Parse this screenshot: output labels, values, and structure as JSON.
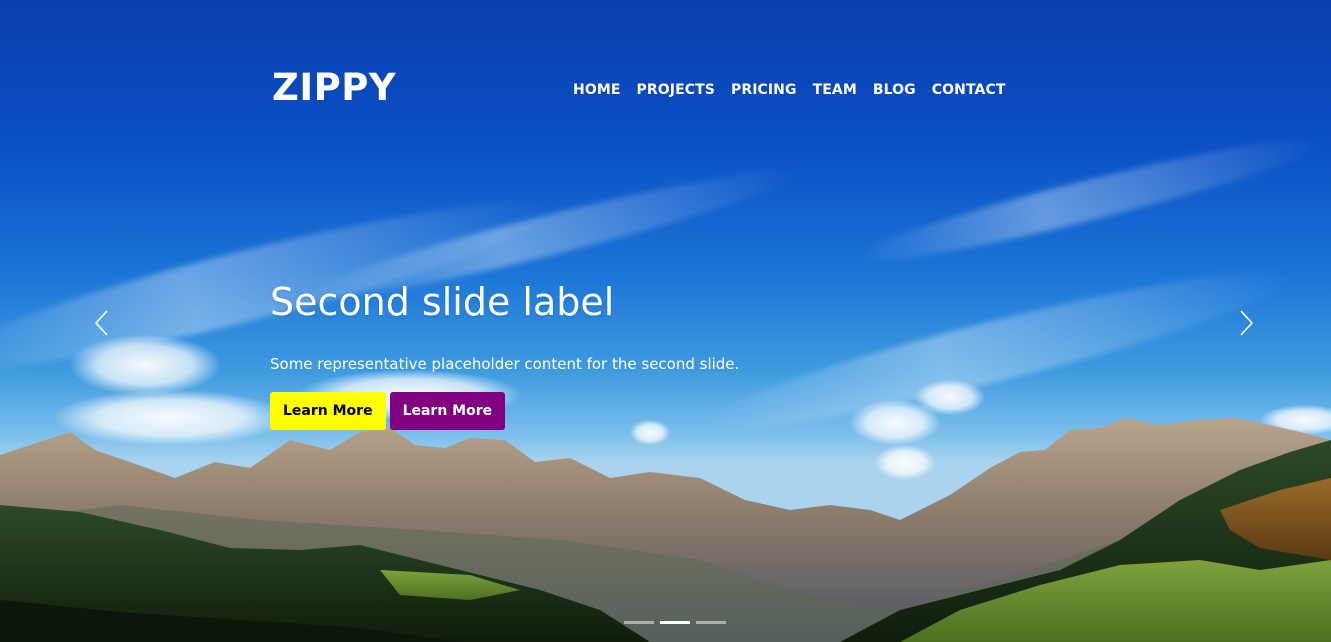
{
  "brand": {
    "name": "ZIPPY"
  },
  "nav": {
    "items": [
      {
        "label": "HOME"
      },
      {
        "label": "PROJECTS"
      },
      {
        "label": "PRICING"
      },
      {
        "label": "TEAM"
      },
      {
        "label": "BLOG"
      },
      {
        "label": "CONTACT"
      }
    ]
  },
  "carousel": {
    "slide_title": "Second slide label",
    "slide_text": "Some representative placeholder content for the second slide.",
    "buttons": [
      {
        "label": "Learn More",
        "color": "#ffff00"
      },
      {
        "label": "Learn More",
        "color": "#800080"
      }
    ],
    "prev_icon": "chevron-left-icon",
    "next_icon": "chevron-right-icon",
    "slide_count": 3,
    "active_slide": 2
  },
  "colors": {
    "sky_top": "#0b3fae",
    "text": "#ffffff",
    "button_yellow": "#ffff00",
    "button_purple": "#800080"
  }
}
